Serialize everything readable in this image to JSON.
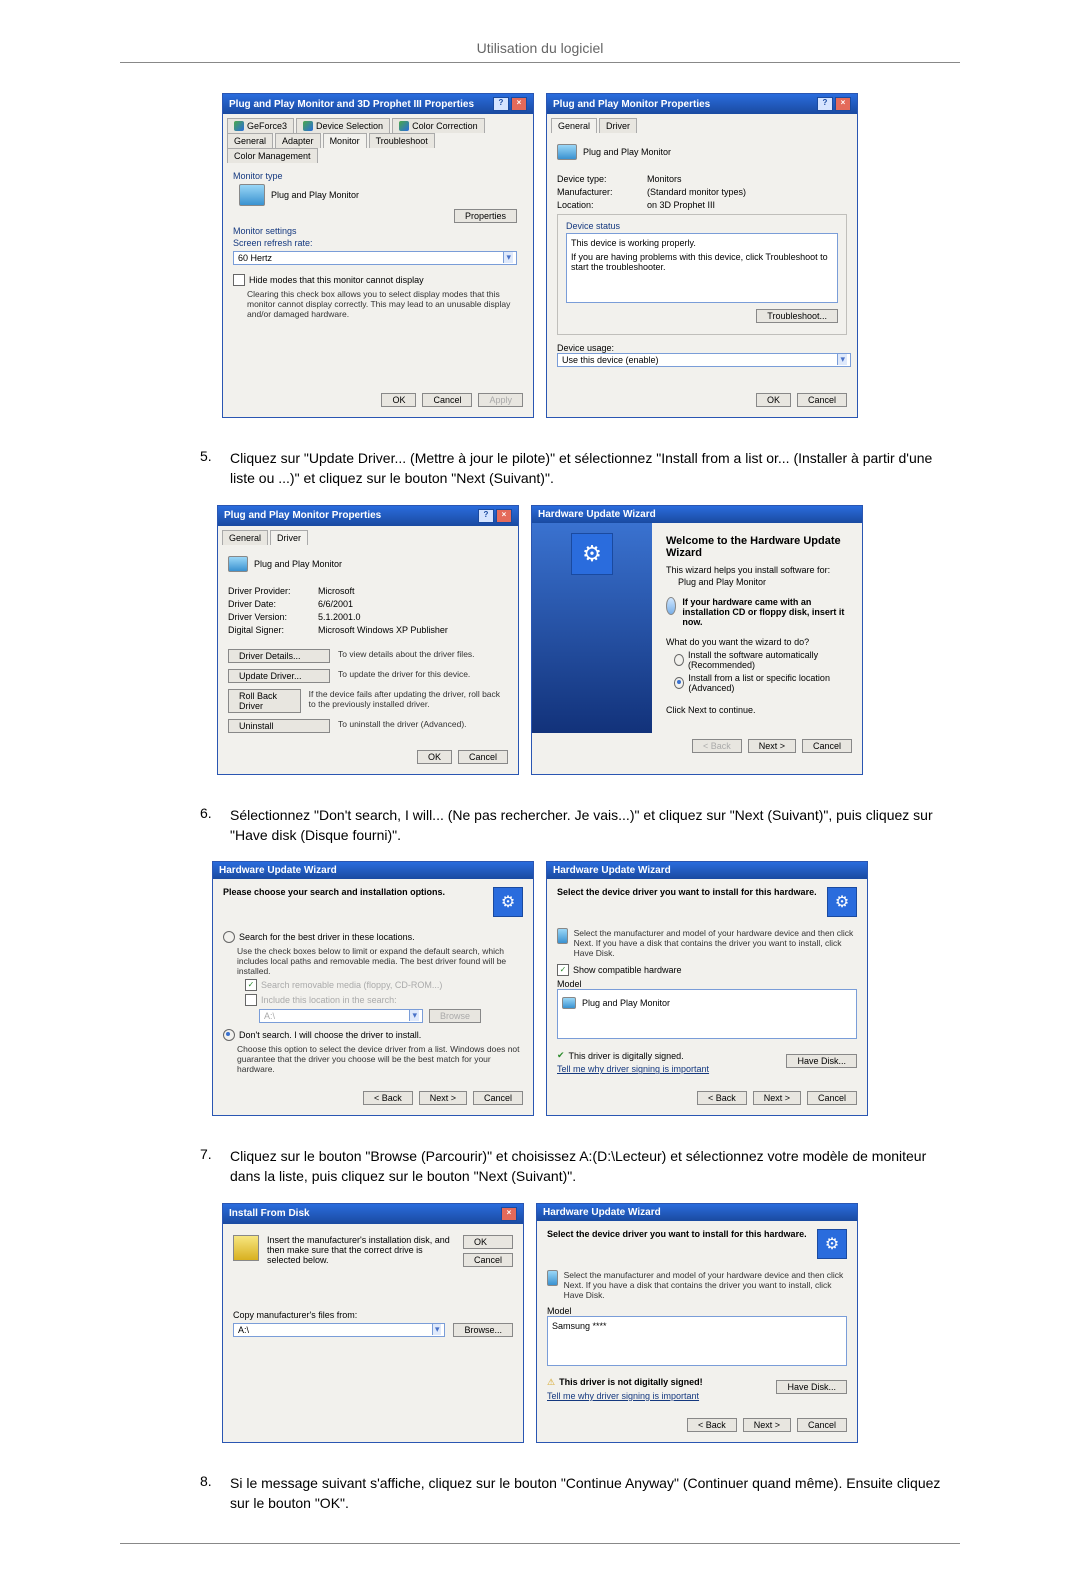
{
  "header": {
    "title": "Utilisation du logiciel"
  },
  "steps": {
    "s5": {
      "num": "5.",
      "text": "Cliquez sur \"Update Driver... (Mettre à jour le pilote)\" et sélectionnez \"Install from a list or... (Installer à partir d'une liste ou ...)\" et cliquez sur le bouton \"Next (Suivant)\"."
    },
    "s6": {
      "num": "6.",
      "text": "Sélectionnez \"Don't search, I will... (Ne pas rechercher. Je vais...)\" et cliquez sur \"Next (Suivant)\", puis cliquez sur \"Have disk (Disque fourni)\"."
    },
    "s7": {
      "num": "7.",
      "text": "Cliquez sur le bouton \"Browse (Parcourir)\" et choisissez A:(D:\\Lecteur) et sélectionnez votre modèle de moniteur dans la liste, puis cliquez sur le bouton \"Next (Suivant)\"."
    },
    "s8": {
      "num": "8.",
      "text": "Si le message suivant s'affiche, cliquez sur le bouton \"Continue Anyway\" (Continuer quand même). Ensuite cliquez sur le bouton \"OK\"."
    }
  },
  "win1": {
    "title": "Plug and Play Monitor and 3D Prophet III Properties",
    "tabs": {
      "geforce": "GeForce3",
      "devsel": "Device Selection",
      "colorcorr": "Color Correction",
      "general": "General",
      "adapter": "Adapter",
      "monitor": "Monitor",
      "troubleshoot": "Troubleshoot",
      "colormgmt": "Color Management"
    },
    "monType": "Monitor type",
    "monName": "Plug and Play Monitor",
    "propertiesBtn": "Properties",
    "monSettings": "Monitor settings",
    "refreshLbl": "Screen refresh rate:",
    "refreshVal": "60 Hertz",
    "hideChk": "Hide modes that this monitor cannot display",
    "hideHelp": "Clearing this check box allows you to select display modes that this monitor cannot display correctly. This may lead to an unusable display and/or damaged hardware.",
    "ok": "OK",
    "cancel": "Cancel",
    "apply": "Apply"
  },
  "win2": {
    "title": "Plug and Play Monitor Properties",
    "tabs": {
      "general": "General",
      "driver": "Driver"
    },
    "monName": "Plug and Play Monitor",
    "devTypeLbl": "Device type:",
    "devTypeVal": "Monitors",
    "mfrLbl": "Manufacturer:",
    "mfrVal": "(Standard monitor types)",
    "locLbl": "Location:",
    "locVal": "on 3D Prophet III",
    "devStatusTitle": "Device status",
    "devStatusLine1": "This device is working properly.",
    "devStatusLine2": "If you are having problems with this device, click Troubleshoot to start the troubleshooter.",
    "troubleshootBtn": "Troubleshoot...",
    "usageLbl": "Device usage:",
    "usageVal": "Use this device (enable)",
    "ok": "OK",
    "cancel": "Cancel"
  },
  "win3": {
    "title": "Plug and Play Monitor Properties",
    "tabs": {
      "general": "General",
      "driver": "Driver"
    },
    "monName": "Plug and Play Monitor",
    "provLbl": "Driver Provider:",
    "provVal": "Microsoft",
    "dateLbl": "Driver Date:",
    "dateVal": "6/6/2001",
    "verLbl": "Driver Version:",
    "verVal": "5.1.2001.0",
    "signLbl": "Digital Signer:",
    "signVal": "Microsoft Windows XP Publisher",
    "detailsBtn": "Driver Details...",
    "detailsHelp": "To view details about the driver files.",
    "updateBtn": "Update Driver...",
    "updateHelp": "To update the driver for this device.",
    "rollbackBtn": "Roll Back Driver",
    "rollbackHelp": "If the device fails after updating the driver, roll back to the previously installed driver.",
    "uninstallBtn": "Uninstall",
    "uninstallHelp": "To uninstall the driver (Advanced).",
    "ok": "OK",
    "cancel": "Cancel"
  },
  "win4": {
    "title": "Hardware Update Wizard",
    "welcome": "Welcome to the Hardware Update Wizard",
    "helps": "This wizard helps you install software for:",
    "monName": "Plug and Play Monitor",
    "cdHint": "If your hardware came with an installation CD or floppy disk, insert it now.",
    "whatDo": "What do you want the wizard to do?",
    "opt1": "Install the software automatically (Recommended)",
    "opt2": "Install from a list or specific location (Advanced)",
    "clickNext": "Click Next to continue.",
    "back": "< Back",
    "next": "Next >",
    "cancel": "Cancel"
  },
  "win5": {
    "title": "Hardware Update Wizard",
    "heading": "Please choose your search and installation options.",
    "opt1": "Search for the best driver in these locations.",
    "opt1help": "Use the check boxes below to limit or expand the default search, which includes local paths and removable media. The best driver found will be installed.",
    "chkFloppy": "Search removable media (floppy, CD-ROM...)",
    "chkInclude": "Include this location in the search:",
    "pathVal": "A:\\",
    "browse": "Browse",
    "opt2": "Don't search. I will choose the driver to install.",
    "opt2help": "Choose this option to select the device driver from a list. Windows does not guarantee that the driver you choose will be the best match for your hardware.",
    "back": "< Back",
    "next": "Next >",
    "cancel": "Cancel"
  },
  "win6": {
    "title": "Hardware Update Wizard",
    "heading": "Select the device driver you want to install for this hardware.",
    "help": "Select the manufacturer and model of your hardware device and then click Next. If you have a disk that contains the driver you want to install, click Have Disk.",
    "showCompat": "Show compatible hardware",
    "modelLbl": "Model",
    "modelItem": "Plug and Play Monitor",
    "signed": "This driver is digitally signed.",
    "tell": "Tell me why driver signing is important",
    "haveDisk": "Have Disk...",
    "back": "< Back",
    "next": "Next >",
    "cancel": "Cancel"
  },
  "win7": {
    "title": "Install From Disk",
    "help": "Insert the manufacturer's installation disk, and then make sure that the correct drive is selected below.",
    "ok": "OK",
    "cancel": "Cancel",
    "copyLbl": "Copy manufacturer's files from:",
    "pathVal": "A:\\",
    "browse": "Browse..."
  },
  "win8": {
    "title": "Hardware Update Wizard",
    "heading": "Select the device driver you want to install for this hardware.",
    "help": "Select the manufacturer and model of your hardware device and then click Next. If you have a disk that contains the driver you want to install, click Have Disk.",
    "modelLbl": "Model",
    "modelItem": "Samsung ****",
    "notSigned": "This driver is not digitally signed!",
    "tell": "Tell me why driver signing is important",
    "haveDisk": "Have Disk...",
    "back": "< Back",
    "next": "Next >",
    "cancel": "Cancel"
  }
}
